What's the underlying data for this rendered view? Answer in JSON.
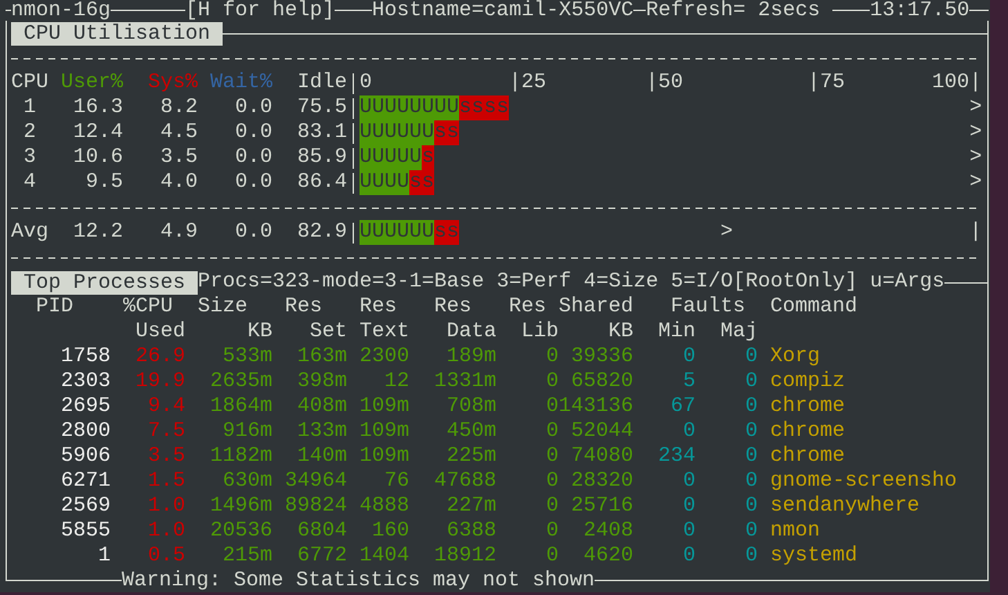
{
  "header": {
    "program": "nmon-16g",
    "help": "[H for help]",
    "hostname": "Hostname=camil-X550VC",
    "refresh": "Refresh= 2secs",
    "time": "13:17.50"
  },
  "cpu_section": {
    "title": "CPU Utilisation",
    "columns": [
      {
        "label": "CPU",
        "color": "#d3d7cf"
      },
      {
        "label": "User%",
        "color": "#4e9a06"
      },
      {
        "label": "Sys%",
        "color": "#cc0000"
      },
      {
        "label": "Wait%",
        "color": "#3465a4"
      },
      {
        "label": "Idle",
        "color": "#d3d7cf"
      }
    ],
    "scale": [
      "0",
      "|25",
      "|50",
      "|75",
      "100|"
    ],
    "rows": [
      {
        "cpu": "1",
        "user": "16.3",
        "sys": "8.2",
        "wait": "0.0",
        "idle": "75.5",
        "user_bar": "UUUUUUUU",
        "sys_bar": "ssss",
        "end_mark": ">"
      },
      {
        "cpu": "2",
        "user": "12.4",
        "sys": "4.5",
        "wait": "0.0",
        "idle": "83.1",
        "user_bar": "UUUUUU",
        "sys_bar": "ss",
        "end_mark": ">"
      },
      {
        "cpu": "3",
        "user": "10.6",
        "sys": "3.5",
        "wait": "0.0",
        "idle": "85.9",
        "user_bar": "UUUUU",
        "sys_bar": "s",
        "end_mark": ">"
      },
      {
        "cpu": "4",
        "user": "9.5",
        "sys": "4.0",
        "wait": "0.0",
        "idle": "86.4",
        "user_bar": "UUUU",
        "sys_bar": "ss",
        "end_mark": ">"
      }
    ],
    "average": {
      "cpu": "Avg",
      "user": "12.2",
      "sys": "4.9",
      "wait": "0.0",
      "idle": "82.9",
      "user_bar": "UUUUUU",
      "sys_bar": "ss",
      "peak_mark": ">",
      "end_mark": "|"
    }
  },
  "processes": {
    "title": "Top Processes",
    "status": "Procs=323-mode=3-1=Base 3=Perf 4=Size 5=I/O[RootOnly] u=Args",
    "header_top": [
      "PID",
      "%CPU",
      "Size",
      "Res",
      "Res",
      "Res",
      "Res",
      "Shared",
      "Faults",
      "Command"
    ],
    "header_bottom": [
      "Used",
      "KB",
      "Set",
      "Text",
      "Data",
      "Lib",
      "KB",
      "Min",
      "Maj"
    ],
    "rows": [
      {
        "pid": "1758",
        "cpu": "26.9",
        "size": "533m",
        "res_set": "163m",
        "res_text": "2300",
        "res_data": "189m",
        "res_lib": "0",
        "shared": "39336",
        "faults_min": "0",
        "faults_maj": "0",
        "command": "Xorg"
      },
      {
        "pid": "2303",
        "cpu": "19.9",
        "size": "2635m",
        "res_set": "398m",
        "res_text": "12",
        "res_data": "1331m",
        "res_lib": "0",
        "shared": "65820",
        "faults_min": "5",
        "faults_maj": "0",
        "command": "compiz"
      },
      {
        "pid": "2695",
        "cpu": "9.4",
        "size": "1864m",
        "res_set": "408m",
        "res_text": "109m",
        "res_data": "708m",
        "res_lib": "0",
        "shared": "143136",
        "faults_min": "67",
        "faults_maj": "0",
        "command": "chrome"
      },
      {
        "pid": "2800",
        "cpu": "7.5",
        "size": "916m",
        "res_set": "133m",
        "res_text": "109m",
        "res_data": "450m",
        "res_lib": "0",
        "shared": "52044",
        "faults_min": "0",
        "faults_maj": "0",
        "command": "chrome"
      },
      {
        "pid": "5906",
        "cpu": "3.5",
        "size": "1182m",
        "res_set": "140m",
        "res_text": "109m",
        "res_data": "225m",
        "res_lib": "0",
        "shared": "74080",
        "faults_min": "234",
        "faults_maj": "0",
        "command": "chrome"
      },
      {
        "pid": "6271",
        "cpu": "1.5",
        "size": "630m",
        "res_set": "34964",
        "res_text": "76",
        "res_data": "47688",
        "res_lib": "0",
        "shared": "28320",
        "faults_min": "0",
        "faults_maj": "0",
        "command": "gnome-screensho"
      },
      {
        "pid": "2569",
        "cpu": "1.0",
        "size": "1496m",
        "res_set": "89824",
        "res_text": "4888",
        "res_data": "227m",
        "res_lib": "0",
        "shared": "25716",
        "faults_min": "0",
        "faults_maj": "0",
        "command": "sendanywhere"
      },
      {
        "pid": "5855",
        "cpu": "1.0",
        "size": "20536",
        "res_set": "6804",
        "res_text": "160",
        "res_data": "6388",
        "res_lib": "0",
        "shared": "2408",
        "faults_min": "0",
        "faults_maj": "0",
        "command": "nmon"
      },
      {
        "pid": "1",
        "cpu": "0.5",
        "size": "215m",
        "res_set": "6772",
        "res_text": "1404",
        "res_data": "18912",
        "res_lib": "0",
        "shared": "4620",
        "faults_min": "0",
        "faults_maj": "0",
        "command": "systemd"
      }
    ]
  },
  "warning": "Warning: Some Statistics may not shown"
}
